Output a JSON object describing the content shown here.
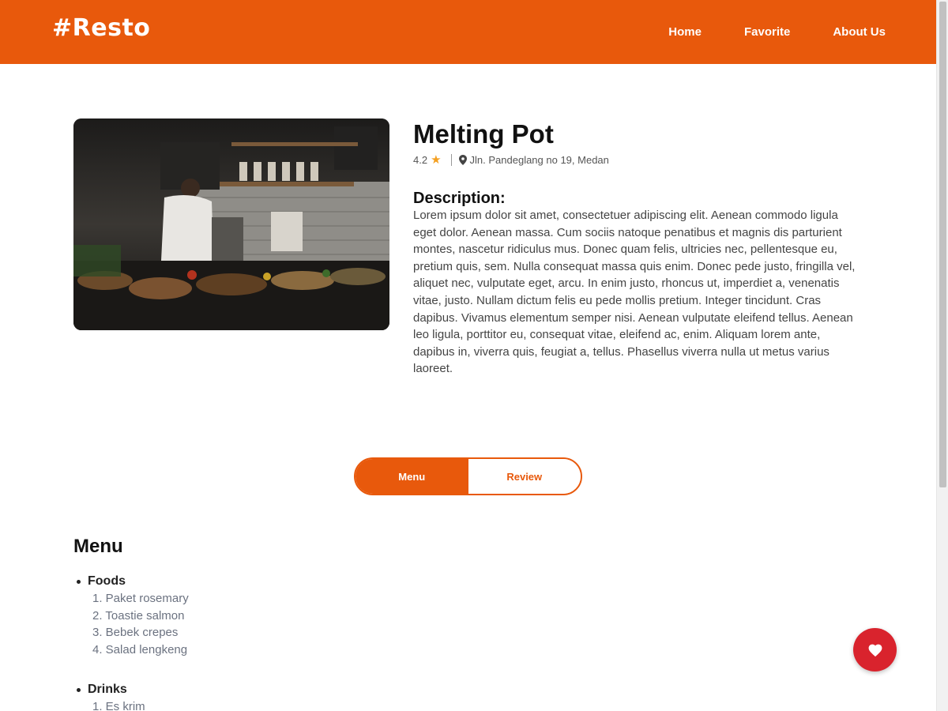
{
  "header": {
    "logo": "#Resto",
    "nav": [
      "Home",
      "Favorite",
      "About Us"
    ]
  },
  "restaurant": {
    "name": "Melting Pot",
    "rating": "4.2",
    "address": "Jln. Pandeglang no 19, Medan",
    "description_title": "Description:",
    "description": "Lorem ipsum dolor sit amet, consectetuer adipiscing elit. Aenean commodo ligula eget dolor. Aenean massa. Cum sociis natoque penatibus et magnis dis parturient montes, nascetur ridiculus mus. Donec quam felis, ultricies nec, pellentesque eu, pretium quis, sem. Nulla consequat massa quis enim. Donec pede justo, fringilla vel, aliquet nec, vulputate eget, arcu. In enim justo, rhoncus ut, imperdiet a, venenatis vitae, justo. Nullam dictum felis eu pede mollis pretium. Integer tincidunt. Cras dapibus. Vivamus elementum semper nisi. Aenean vulputate eleifend tellus. Aenean leo ligula, porttitor eu, consequat vitae, eleifend ac, enim. Aliquam lorem ante, dapibus in, viverra quis, feugiat a, tellus. Phasellus viverra nulla ut metus varius laoreet."
  },
  "tabs": {
    "menu": "Menu",
    "review": "Review",
    "active": "Menu"
  },
  "menu": {
    "title": "Menu",
    "foods_label": "Foods",
    "foods": [
      "1. Paket rosemary",
      "2. Toastie salmon",
      "3. Bebek crepes",
      "4. Salad lengkeng"
    ],
    "drinks_label": "Drinks",
    "drinks": [
      "1. Es krim"
    ]
  },
  "icons": {
    "rating": "star-icon",
    "location": "map-pin-icon",
    "favorite": "heart-icon"
  },
  "colors": {
    "brand": "#e8590c",
    "favorite": "#d9232d",
    "star": "#f4a021"
  }
}
